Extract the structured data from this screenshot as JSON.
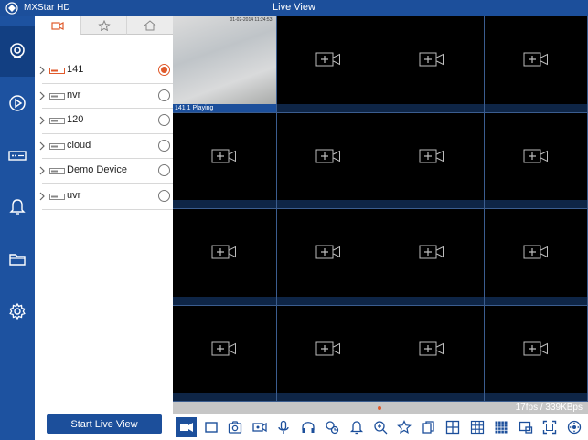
{
  "app": {
    "name": "MXStar HD",
    "window_title": "Live View"
  },
  "nav": {
    "items": [
      {
        "icon": "live-camera-icon"
      },
      {
        "icon": "playback-icon"
      },
      {
        "icon": "device-icon"
      },
      {
        "icon": "alarm-bell-icon"
      },
      {
        "icon": "folder-icon"
      },
      {
        "icon": "settings-gear-icon"
      }
    ]
  },
  "panel": {
    "tabs": [
      {
        "icon": "camera-tab-icon"
      },
      {
        "icon": "favorite-tab-icon"
      },
      {
        "icon": "home-tab-icon"
      }
    ],
    "devices": [
      {
        "name": "141",
        "selected": true
      },
      {
        "name": "nvr",
        "selected": false
      },
      {
        "name": "120",
        "selected": false
      },
      {
        "name": "cloud",
        "selected": false
      },
      {
        "name": "Demo Device",
        "selected": false
      },
      {
        "name": "uvr",
        "selected": false
      }
    ],
    "start_button": "Start Live View"
  },
  "grid": {
    "playing_label": "141 1  Playing",
    "feed_timestamp": "01-02-2014 11:24:53"
  },
  "status": {
    "fps": "17fps / 339KBps"
  },
  "colors": {
    "accent": "#1c4f9b",
    "selected": "#e05a2b"
  }
}
